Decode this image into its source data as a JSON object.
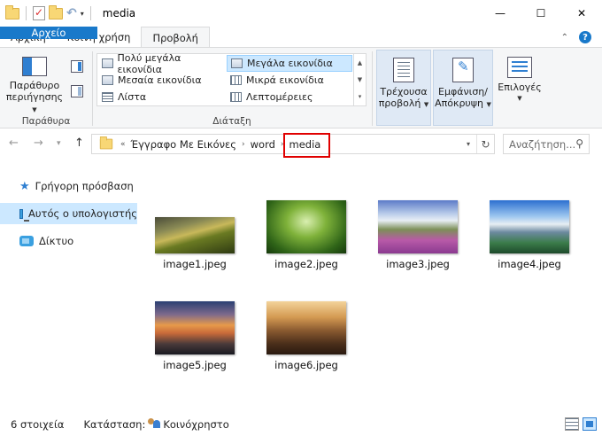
{
  "window": {
    "title": "media",
    "minimize": "—",
    "maximize": "☐",
    "close": "✕"
  },
  "ribbon_tabs": {
    "file": "Αρχείο",
    "home": "Αρχική",
    "share": "Κοινή χρήση",
    "view": "Προβολή",
    "collapse_glyph": "⌃",
    "help_glyph": "?"
  },
  "panes_group": {
    "label": "Παράθυρα",
    "nav_pane_line1": "Παράθυρο",
    "nav_pane_line2": "περιήγησης"
  },
  "layout_group": {
    "label": "Διάταξη",
    "items": [
      "Πολύ μεγάλα εικονίδια",
      "Μεγάλα εικονίδια",
      "Μεσαία εικονίδια",
      "Μικρά εικονίδια",
      "Λίστα",
      "Λεπτομέρειες"
    ],
    "selected_index": 1
  },
  "view_group": {
    "current_view_line1": "Τρέχουσα",
    "current_view_line2": "προβολή",
    "show_hide_line1": "Εμφάνιση/",
    "show_hide_line2": "Απόκρυψη",
    "options": "Επιλογές"
  },
  "address_bar": {
    "overflow": "«",
    "crumbs": [
      "Έγγραφο Με Εικόνες",
      "word",
      "media"
    ],
    "separator": "›",
    "search_placeholder": "Αναζήτηση..."
  },
  "nav_pane": {
    "items": [
      "Γρήγορη πρόσβαση",
      "Αυτός ο υπολογιστής",
      "Δίκτυο"
    ],
    "selected_index": 1
  },
  "files": [
    {
      "name": "image1.jpeg"
    },
    {
      "name": "image2.jpeg"
    },
    {
      "name": "image3.jpeg"
    },
    {
      "name": "image4.jpeg"
    },
    {
      "name": "image5.jpeg"
    },
    {
      "name": "image6.jpeg"
    }
  ],
  "status_bar": {
    "item_count": "6 στοιχεία",
    "state_label": "Κατάσταση:",
    "state_value": "Κοινόχρηστο"
  },
  "colors": {
    "accent": "#1979ca",
    "selection": "#cce8ff",
    "highlight_box": "#e00000"
  }
}
